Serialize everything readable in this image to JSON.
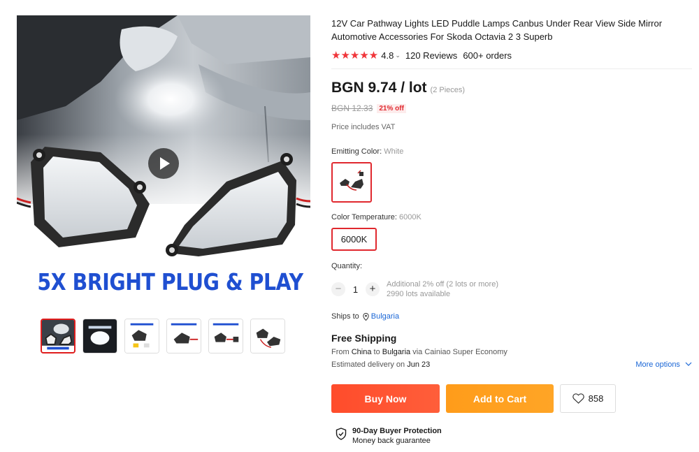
{
  "gallery": {
    "banner_text": "5X BRIGHT   PLUG & PLAY",
    "thumbnail_count": 6,
    "active_thumbnail": 1
  },
  "product": {
    "title": "12V Car Pathway Lights LED Puddle Lamps Canbus Under Rear View Side Mirror Automotive Accessories For Skoda Octavia 2 3 Superb",
    "stars": "★★★★★",
    "rating": "4.8",
    "reviews": "120 Reviews",
    "orders": "600+ orders"
  },
  "price": {
    "current": "BGN 9.74 / lot",
    "pieces": "(2 Pieces)",
    "original": "BGN 12.33",
    "discount": "21% off",
    "vat_note": "Price includes VAT"
  },
  "options": {
    "color_label": "Emitting Color: ",
    "color_value": "White",
    "temp_label": "Color Temperature: ",
    "temp_value": "6000K",
    "temp_selected": "6000K"
  },
  "quantity": {
    "label": "Quantity:",
    "minus": "−",
    "value": "1",
    "plus": "+",
    "note1": "Additional 2% off (2 lots or more)",
    "note2": "2990 lots available"
  },
  "shipping": {
    "ships_to_label": "Ships to",
    "country": "Bulgaria",
    "free_shipping": "Free Shipping",
    "from_label": "From ",
    "from_country": "China",
    "to_label": " to ",
    "to_country": "Bulgaria",
    "via": " via Cainiao Super Economy",
    "eta_label": "Estimated delivery on ",
    "eta_date": "Jun 23",
    "more_options": "More options"
  },
  "actions": {
    "buy_now": "Buy Now",
    "add_to_cart": "Add to Cart",
    "wishlist_count": "858"
  },
  "protection": {
    "title": "90-Day Buyer Protection",
    "subtitle": "Money back guarantee"
  },
  "colors": {
    "accent_red": "#e0282e",
    "buy_now": "#ff4c2b",
    "add_to_cart": "#ff9c1a",
    "link_blue": "#1a66d6",
    "banner_blue": "#1f4fd1"
  }
}
